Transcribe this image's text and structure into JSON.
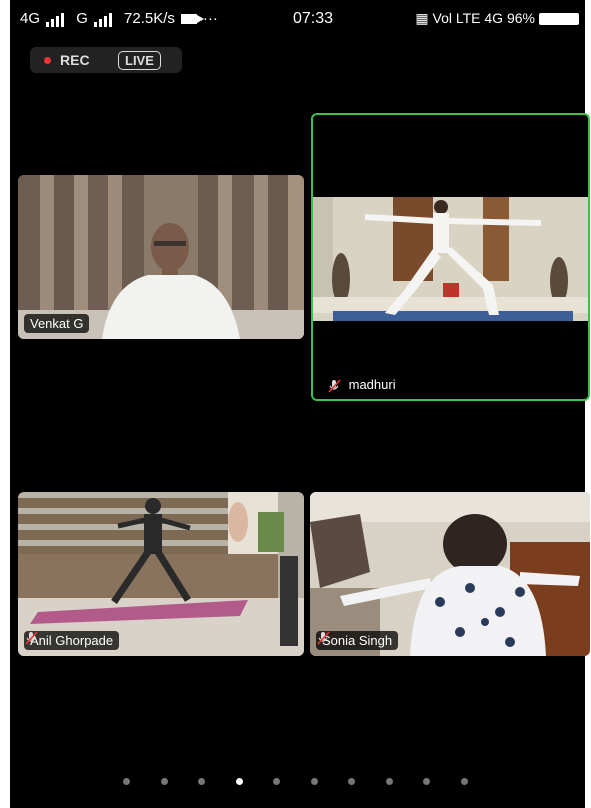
{
  "status_bar": {
    "network1": "4G",
    "network2": "G",
    "speed": "72.5K/s",
    "more": "···",
    "time": "07:33",
    "right_icons": "Vol LTE 4G",
    "battery": "96%"
  },
  "recording": {
    "rec_label": "REC",
    "live_label": "LIVE"
  },
  "participants": [
    {
      "name": "Venkat G",
      "muted": false
    },
    {
      "name": "madhuri",
      "muted": true,
      "active_speaker": true
    },
    {
      "name": "Anil Ghorpade",
      "muted": true
    },
    {
      "name": "Sonia Singh",
      "muted": true
    }
  ],
  "pagination": {
    "total": 10,
    "active_index": 3
  },
  "colors": {
    "active_border": "#3cc24a",
    "rec_dot": "#e33333"
  }
}
